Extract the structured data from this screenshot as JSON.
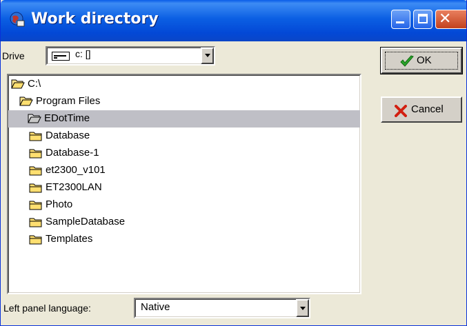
{
  "window": {
    "title": "Work directory"
  },
  "drive": {
    "label": "Drive",
    "value": "c: []"
  },
  "tree": {
    "items": [
      {
        "label": "C:\\",
        "state": "open",
        "level": 0
      },
      {
        "label": "Program Files",
        "state": "open",
        "level": 1
      },
      {
        "label": "EDotTime",
        "state": "open-selected",
        "level": 2
      },
      {
        "label": "Database",
        "state": "closed",
        "level": 3
      },
      {
        "label": "Database-1",
        "state": "closed",
        "level": 3
      },
      {
        "label": "et2300_v101",
        "state": "closed",
        "level": 3
      },
      {
        "label": "ET2300LAN",
        "state": "closed",
        "level": 3
      },
      {
        "label": "Photo",
        "state": "closed",
        "level": 3
      },
      {
        "label": "SampleDatabase",
        "state": "closed",
        "level": 3
      },
      {
        "label": "Templates",
        "state": "closed",
        "level": 3
      }
    ],
    "selected_index": 2
  },
  "buttons": {
    "ok": "OK",
    "cancel": "Cancel"
  },
  "language": {
    "label": "Left panel language:",
    "value": "Native"
  },
  "colors": {
    "selection": "#bfbfc6",
    "folder": "#ffdf70",
    "ok_check": "#2ba52b",
    "cancel_x": "#d21f10"
  }
}
